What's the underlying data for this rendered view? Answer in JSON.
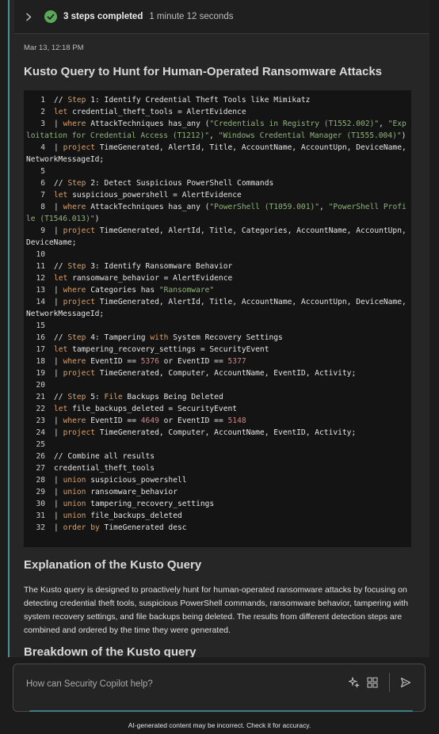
{
  "steps": {
    "title": "3 steps completed",
    "duration": "1 minute 12 seconds"
  },
  "message": {
    "timestamp": "Mar 13, 12:18 PM",
    "title": "Kusto Query to Hunt for Human-Operated Ransomware Attacks"
  },
  "code_lines": [
    {
      "n": "1",
      "t": [
        [
          "cm",
          "// "
        ],
        [
          "kw",
          "Step"
        ],
        [
          "cm",
          " 1: Identify Credential Theft Tools like Mimikatz"
        ]
      ]
    },
    {
      "n": "2",
      "t": [
        [
          "kw",
          "let"
        ],
        [
          "p",
          " credential_theft_tools = AlertEvidence"
        ]
      ]
    },
    {
      "n": "3",
      "t": [
        [
          "p",
          "| "
        ],
        [
          "kw",
          "where"
        ],
        [
          "p",
          " AttackTechniques has_any ("
        ],
        [
          "str",
          "\"Credentials in Registry (T1552.002)\""
        ],
        [
          "p",
          ", "
        ],
        [
          "str",
          "\"Exploitation for Credential Access (T1212)\""
        ],
        [
          "p",
          ", "
        ],
        [
          "str",
          "\"Windows Credential Manager (T1555.004)\""
        ],
        [
          "p",
          ")"
        ]
      ]
    },
    {
      "n": "4",
      "t": [
        [
          "p",
          "| "
        ],
        [
          "kw",
          "project"
        ],
        [
          "p",
          " TimeGenerated, AlertId, Title, AccountName, AccountUpn, DeviceName, NetworkMessageId;"
        ]
      ]
    },
    {
      "n": "5",
      "t": []
    },
    {
      "n": "6",
      "t": [
        [
          "cm",
          "// "
        ],
        [
          "kw",
          "Step"
        ],
        [
          "cm",
          " 2: Detect Suspicious PowerShell Commands"
        ]
      ]
    },
    {
      "n": "7",
      "t": [
        [
          "kw",
          "let"
        ],
        [
          "p",
          " suspicious_powershell = AlertEvidence"
        ]
      ]
    },
    {
      "n": "8",
      "t": [
        [
          "p",
          "| "
        ],
        [
          "kw",
          "where"
        ],
        [
          "p",
          " AttackTechniques has_any ("
        ],
        [
          "str",
          "\"PowerShell (T1059.001)\""
        ],
        [
          "p",
          ", "
        ],
        [
          "str",
          "\"PowerShell Profile (T1546.013)\""
        ],
        [
          "p",
          ")"
        ]
      ]
    },
    {
      "n": "9",
      "t": [
        [
          "p",
          "| "
        ],
        [
          "kw",
          "project"
        ],
        [
          "p",
          " TimeGenerated, AlertId, Title, Categories, AccountName, AccountUpn, DeviceName;"
        ]
      ]
    },
    {
      "n": "10",
      "t": []
    },
    {
      "n": "11",
      "t": [
        [
          "cm",
          "// "
        ],
        [
          "kw",
          "Step"
        ],
        [
          "cm",
          " 3: Identify Ransomware Behavior"
        ]
      ]
    },
    {
      "n": "12",
      "t": [
        [
          "kw",
          "let"
        ],
        [
          "p",
          " ransomware_behavior = AlertEvidence"
        ]
      ]
    },
    {
      "n": "13",
      "t": [
        [
          "p",
          "| "
        ],
        [
          "kw",
          "where"
        ],
        [
          "p",
          " Categories has "
        ],
        [
          "str",
          "\"Ransomware\""
        ]
      ]
    },
    {
      "n": "14",
      "t": [
        [
          "p",
          "| "
        ],
        [
          "kw",
          "project"
        ],
        [
          "p",
          " TimeGenerated, AlertId, Title, AccountName, AccountUpn, DeviceName, NetworkMessageId;"
        ]
      ]
    },
    {
      "n": "15",
      "t": []
    },
    {
      "n": "16",
      "t": [
        [
          "cm",
          "// "
        ],
        [
          "kw",
          "Step"
        ],
        [
          "cm",
          " 4: Tampering "
        ],
        [
          "kw",
          "with"
        ],
        [
          "cm",
          " System Recovery Settings"
        ]
      ]
    },
    {
      "n": "17",
      "t": [
        [
          "kw",
          "let"
        ],
        [
          "p",
          " tampering_recovery_settings = SecurityEvent"
        ]
      ]
    },
    {
      "n": "18",
      "t": [
        [
          "p",
          "| "
        ],
        [
          "kw",
          "where"
        ],
        [
          "p",
          " EventID == "
        ],
        [
          "num",
          "5376"
        ],
        [
          "p",
          " or EventID == "
        ],
        [
          "num",
          "5377"
        ]
      ]
    },
    {
      "n": "19",
      "t": [
        [
          "p",
          "| "
        ],
        [
          "kw",
          "project"
        ],
        [
          "p",
          " TimeGenerated, Computer, AccountName, EventID, Activity;"
        ]
      ]
    },
    {
      "n": "20",
      "t": []
    },
    {
      "n": "21",
      "t": [
        [
          "cm",
          "// "
        ],
        [
          "kw",
          "Step"
        ],
        [
          "cm",
          " 5: "
        ],
        [
          "kw",
          "File"
        ],
        [
          "cm",
          " Backups Being Deleted"
        ]
      ]
    },
    {
      "n": "22",
      "t": [
        [
          "kw",
          "let"
        ],
        [
          "p",
          " file_backups_deleted = SecurityEvent"
        ]
      ]
    },
    {
      "n": "23",
      "t": [
        [
          "p",
          "| "
        ],
        [
          "kw",
          "where"
        ],
        [
          "p",
          " EventID == "
        ],
        [
          "num",
          "4649"
        ],
        [
          "p",
          " or EventID == "
        ],
        [
          "num",
          "5148"
        ]
      ]
    },
    {
      "n": "24",
      "t": [
        [
          "p",
          "| "
        ],
        [
          "kw",
          "project"
        ],
        [
          "p",
          " TimeGenerated, Computer, AccountName, EventID, Activity;"
        ]
      ]
    },
    {
      "n": "25",
      "t": []
    },
    {
      "n": "26",
      "t": [
        [
          "cm",
          "// Combine all results"
        ]
      ]
    },
    {
      "n": "27",
      "t": [
        [
          "p",
          "credential_theft_tools"
        ]
      ]
    },
    {
      "n": "28",
      "t": [
        [
          "p",
          "| "
        ],
        [
          "kw",
          "union"
        ],
        [
          "p",
          " suspicious_powershell"
        ]
      ]
    },
    {
      "n": "29",
      "t": [
        [
          "p",
          "| "
        ],
        [
          "kw",
          "union"
        ],
        [
          "p",
          " ransomware_behavior"
        ]
      ]
    },
    {
      "n": "30",
      "t": [
        [
          "p",
          "| "
        ],
        [
          "kw",
          "union"
        ],
        [
          "p",
          " tampering_recovery_settings"
        ]
      ]
    },
    {
      "n": "31",
      "t": [
        [
          "p",
          "| "
        ],
        [
          "kw",
          "union"
        ],
        [
          "p",
          " file_backups_deleted"
        ]
      ]
    },
    {
      "n": "32",
      "t": [
        [
          "p",
          "| "
        ],
        [
          "kw",
          "order by"
        ],
        [
          "p",
          " TimeGenerated desc"
        ]
      ]
    }
  ],
  "explanation": {
    "title": "Explanation of the Kusto Query",
    "body": "The Kusto query is designed to proactively hunt for human-operated ransomware attacks by focusing on detecting credential theft tools, suspicious PowerShell commands, ransomware behavior, tampering with system recovery settings, and file backups being deleted. The results from different detection steps are combined and ordered by the time they were generated."
  },
  "breakdown_title": "Breakdown of the Kusto query",
  "prompt": {
    "placeholder": "How can Security Copilot help?"
  },
  "icons": {
    "expand": "chevron-right-icon",
    "status": "check-circle-icon",
    "sparkle": "sparkle-icon",
    "prompts": "prompt-gallery-icon",
    "send": "send-icon"
  },
  "colors": {
    "accent": "#4a8f93",
    "success": "#5aa85a",
    "keyword": "#d9a06a",
    "string": "#8fb37a",
    "number": "#c98686"
  },
  "disclaimer": "AI-generated content may be incorrect. Check it for accuracy."
}
